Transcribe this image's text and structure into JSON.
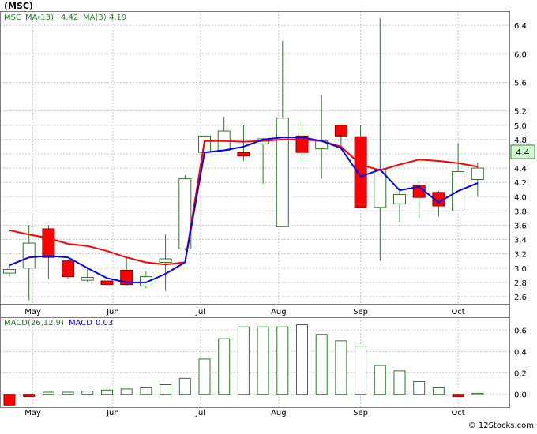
{
  "chart_data": [
    {
      "type": "candlestick",
      "title": "(MSC)",
      "legend": {
        "ticker": "MSC",
        "ma13_label": "MA(13)",
        "ma13_value": "4.42",
        "ma3_label": "MA(3)",
        "ma3_value": "4.19"
      },
      "last_price_label": "4.4",
      "ylim": [
        2.5,
        6.6
      ],
      "yticks": [
        2.6,
        2.8,
        3.0,
        3.2,
        3.4,
        3.6,
        3.8,
        4.0,
        4.2,
        4.4,
        4.6,
        4.8,
        5.0,
        5.2,
        5.6,
        6.0,
        6.4
      ],
      "ytick_labels": [
        "2.6",
        "2.8",
        "3.0",
        "3.2",
        "3.4",
        "3.6",
        "3.8",
        "4.0",
        "4.2",
        "4.4",
        "4.6",
        "4.8",
        "5.0",
        "5.2",
        "5.6",
        "6.0",
        "6.4"
      ],
      "x_axis": [
        {
          "label": "May",
          "x": 1.2
        },
        {
          "label": "Jun",
          "x": 5.3
        },
        {
          "label": "Jul",
          "x": 9.8
        },
        {
          "label": "Aug",
          "x": 13.8
        },
        {
          "label": "Sep",
          "x": 18.0
        },
        {
          "label": "Oct",
          "x": 23.0
        }
      ],
      "candles": [
        {
          "x": 0,
          "open": 2.93,
          "close": 2.98,
          "high": 3.03,
          "low": 2.88
        },
        {
          "x": 1,
          "open": 3.0,
          "close": 3.35,
          "high": 3.6,
          "low": 2.55
        },
        {
          "x": 2,
          "open": 3.55,
          "close": 3.15,
          "high": 3.6,
          "low": 2.85
        },
        {
          "x": 3,
          "open": 3.1,
          "close": 2.88,
          "high": 3.12,
          "low": 2.85
        },
        {
          "x": 4,
          "open": 2.83,
          "close": 2.87,
          "high": 3.0,
          "low": 2.8
        },
        {
          "x": 5,
          "open": 2.82,
          "close": 2.77,
          "high": 2.85,
          "low": 2.74
        },
        {
          "x": 6,
          "open": 2.97,
          "close": 2.77,
          "high": 3.15,
          "low": 2.75
        },
        {
          "x": 7,
          "open": 2.75,
          "close": 2.88,
          "high": 2.95,
          "low": 2.72
        },
        {
          "x": 8,
          "open": 3.08,
          "close": 3.13,
          "high": 3.47,
          "low": 2.68
        },
        {
          "x": 9,
          "open": 3.27,
          "close": 4.25,
          "high": 4.3,
          "low": 3.25
        },
        {
          "x": 10,
          "open": 4.62,
          "close": 4.85,
          "high": 4.85,
          "low": 4.62
        },
        {
          "x": 11,
          "open": 4.65,
          "close": 4.92,
          "high": 5.12,
          "low": 4.65
        },
        {
          "x": 12,
          "open": 4.62,
          "close": 4.57,
          "high": 5.0,
          "low": 4.5
        },
        {
          "x": 13,
          "open": 4.74,
          "close": 4.81,
          "high": 4.82,
          "low": 4.18
        },
        {
          "x": 14,
          "open": 3.58,
          "close": 5.1,
          "high": 6.18,
          "low": 3.58
        },
        {
          "x": 15,
          "open": 4.85,
          "close": 4.62,
          "high": 5.05,
          "low": 4.48
        },
        {
          "x": 16,
          "open": 4.67,
          "close": 4.78,
          "high": 5.42,
          "low": 4.25
        },
        {
          "x": 17,
          "open": 5.0,
          "close": 4.85,
          "high": 5.0,
          "low": 4.65
        },
        {
          "x": 18,
          "open": 4.84,
          "close": 3.85,
          "high": 5.0,
          "low": 3.85
        },
        {
          "x": 19,
          "open": 3.85,
          "close": 4.38,
          "high": 6.5,
          "low": 3.1
        },
        {
          "x": 20,
          "open": 3.9,
          "close": 4.03,
          "high": 4.12,
          "low": 3.65
        },
        {
          "x": 21,
          "open": 4.16,
          "close": 3.99,
          "high": 4.2,
          "low": 3.7
        },
        {
          "x": 22,
          "open": 4.06,
          "close": 3.87,
          "high": 4.08,
          "low": 3.72
        },
        {
          "x": 23,
          "open": 3.8,
          "close": 4.35,
          "high": 4.75,
          "low": 3.8
        },
        {
          "x": 24,
          "open": 4.24,
          "close": 4.4,
          "high": 4.48,
          "low": 4.0
        }
      ],
      "series": [
        {
          "name": "MA(13)",
          "color": "#ff0000",
          "x": [
            0,
            1,
            2,
            3,
            4,
            5,
            6,
            7,
            8,
            9,
            10,
            11,
            12,
            13,
            14,
            15,
            16,
            17,
            18,
            19,
            20,
            21,
            22,
            23,
            24
          ],
          "values": [
            3.53,
            3.47,
            3.42,
            3.34,
            3.31,
            3.24,
            3.15,
            3.08,
            3.05,
            3.08,
            4.78,
            4.78,
            4.77,
            4.78,
            4.8,
            4.8,
            4.78,
            4.7,
            4.45,
            4.37,
            4.45,
            4.52,
            4.5,
            4.47,
            4.42
          ]
        },
        {
          "name": "MA(3)",
          "color": "#0000ff",
          "x": [
            0,
            1,
            2,
            3,
            4,
            5,
            6,
            7,
            8,
            9,
            10,
            11,
            12,
            13,
            14,
            15,
            16,
            17,
            18,
            19,
            20,
            21,
            22,
            23,
            24
          ],
          "values": [
            3.04,
            3.15,
            3.17,
            3.15,
            3.0,
            2.86,
            2.8,
            2.8,
            2.92,
            3.08,
            4.62,
            4.65,
            4.7,
            4.8,
            4.83,
            4.83,
            4.78,
            4.68,
            4.28,
            4.38,
            4.09,
            4.14,
            3.92,
            4.08,
            4.19
          ]
        }
      ],
      "series_render": [
        {
          "series": 0,
          "x": [
            0,
            1,
            2,
            3,
            4,
            5,
            6,
            7,
            8,
            9,
            10,
            11,
            12,
            13,
            14,
            15,
            16,
            17,
            18,
            19,
            20,
            21,
            22,
            23,
            24
          ],
          "values": [
            3.53,
            3.47,
            3.42,
            3.34,
            3.31,
            3.24,
            3.15,
            3.08,
            3.05,
            3.08,
            4.78,
            4.78,
            4.77,
            4.78,
            4.8,
            4.8,
            4.78,
            4.7,
            4.45,
            4.37,
            4.45,
            4.52,
            4.5,
            4.47,
            4.42
          ]
        }
      ]
    },
    {
      "type": "bar",
      "title": "",
      "legend": {
        "label": "MACD(26,12,9)",
        "value_label": "MACD",
        "value": "0.03"
      },
      "ylim": [
        -0.12,
        0.72
      ],
      "yticks": [
        0.0,
        0.2,
        0.4,
        0.6
      ],
      "ytick_labels": [
        "0.0",
        "0.2",
        "0.4",
        "0.6"
      ],
      "x_axis": [
        {
          "label": "May",
          "x": 1.2
        },
        {
          "label": "Jun",
          "x": 5.3
        },
        {
          "label": "Jul",
          "x": 9.8
        },
        {
          "label": "Aug",
          "x": 13.8
        },
        {
          "label": "Sep",
          "x": 18.0
        },
        {
          "label": "Oct",
          "x": 23.0
        }
      ],
      "x": [
        0,
        1,
        2,
        3,
        4,
        5,
        6,
        7,
        8,
        9,
        10,
        11,
        12,
        13,
        14,
        15,
        16,
        17,
        18,
        19,
        20,
        21,
        22,
        23,
        24
      ],
      "values": [
        -0.1,
        -0.02,
        0.02,
        0.02,
        0.03,
        0.04,
        0.05,
        0.06,
        0.09,
        0.15,
        0.33,
        0.52,
        0.63,
        0.63,
        0.63,
        0.65,
        0.56,
        0.5,
        0.45,
        0.27,
        0.22,
        0.12,
        0.06,
        -0.02,
        0.01,
        0.02
      ]
    }
  ],
  "footer": {
    "copyright": "© 12Stocks.com"
  },
  "colors": {
    "up": "#ffffff",
    "down": "#ff0000",
    "candle_stroke": "#2b7a2b",
    "grid": "#c8c8c8",
    "ma13": "#ff0000",
    "ma3": "#0000ff",
    "macd_bar": "#2b7a2b",
    "macd_neg": "#ff0000"
  }
}
